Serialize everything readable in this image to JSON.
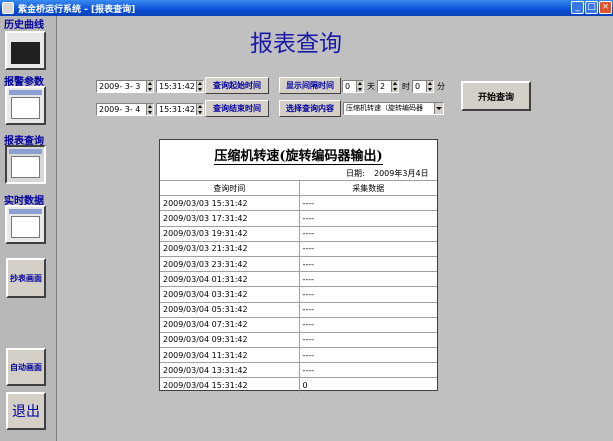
{
  "window": {
    "title": "紫金桥运行系统 - [报表查询]",
    "minimize": "_",
    "maximize": "□",
    "close": "×"
  },
  "sidebar": {
    "history_label": "历史曲线",
    "alarm_label": "报警参数",
    "report_label": "报表查询",
    "realtime_label": "实时数据",
    "copy_button": "抄表画面",
    "auto_button": "自动画面",
    "exit_button": "退出"
  },
  "page_title": "报表查询",
  "controls": {
    "start_date": "2009- 3- 3",
    "start_time": "15:31:42",
    "start_button": "查询起始时间",
    "end_date": "2009- 3- 4",
    "end_time": "15:31:42",
    "end_button": "查询结束时间",
    "interval_button": "显示间隔时间",
    "interval_days": "0",
    "unit_day": "天",
    "interval_hours": "2",
    "unit_hour": "时",
    "interval_minutes": "0",
    "unit_minute": "分",
    "content_button": "选择查询内容",
    "content_selected": "压缩机转速（旋转编码器",
    "start_query_button": "开始查询"
  },
  "report": {
    "title": "压缩机转速(旋转编码器输出)",
    "date_label": "日期:",
    "date_value": "2009年3月4日",
    "columns": [
      "查询时间",
      "采集数据"
    ],
    "rows": [
      {
        "time": "2009/03/03 15:31:42",
        "value": "----"
      },
      {
        "time": "2009/03/03 17:31:42",
        "value": "----"
      },
      {
        "time": "2009/03/03 19:31:42",
        "value": "----"
      },
      {
        "time": "2009/03/03 21:31:42",
        "value": "----"
      },
      {
        "time": "2009/03/03 23:31:42",
        "value": "----"
      },
      {
        "time": "2009/03/04 01:31:42",
        "value": "----"
      },
      {
        "time": "2009/03/04 03:31:42",
        "value": "----"
      },
      {
        "time": "2009/03/04 05:31:42",
        "value": "----"
      },
      {
        "time": "2009/03/04 07:31:42",
        "value": "----"
      },
      {
        "time": "2009/03/04 09:31:42",
        "value": "----"
      },
      {
        "time": "2009/03/04 11:31:42",
        "value": "----"
      },
      {
        "time": "2009/03/04 13:31:42",
        "value": "----"
      },
      {
        "time": "2009/03/04 15:31:42",
        "value": "0"
      }
    ]
  }
}
